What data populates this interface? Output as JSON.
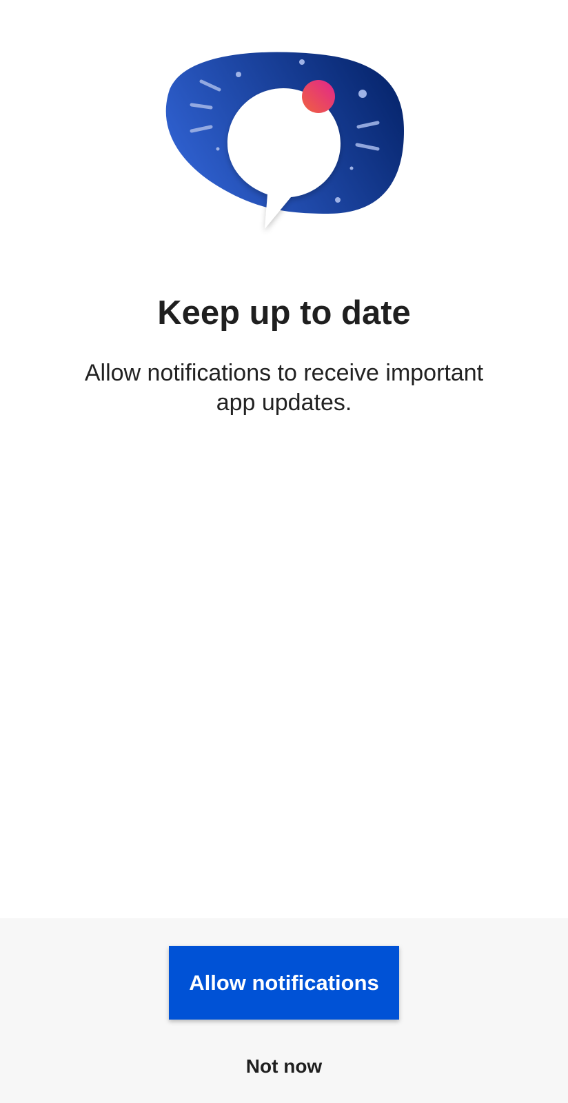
{
  "illustration": {
    "icon": "notification-speech-bubble-illustration",
    "colors": {
      "blob_dark": "#07266e",
      "blob_light": "#3163d4",
      "bubble": "#ffffff",
      "line_start": "#f5713a",
      "line_end": "#e1258d",
      "badge": "#e8356e"
    }
  },
  "title": "Keep up to date",
  "subtitle": "Allow notifications to receive important app updates.",
  "actions": {
    "primary_label": "Allow notifications",
    "secondary_label": "Not now"
  },
  "colors": {
    "primary_button": "#0052d6",
    "footer_background": "#f7f7f7",
    "text": "#1f1f1f"
  }
}
